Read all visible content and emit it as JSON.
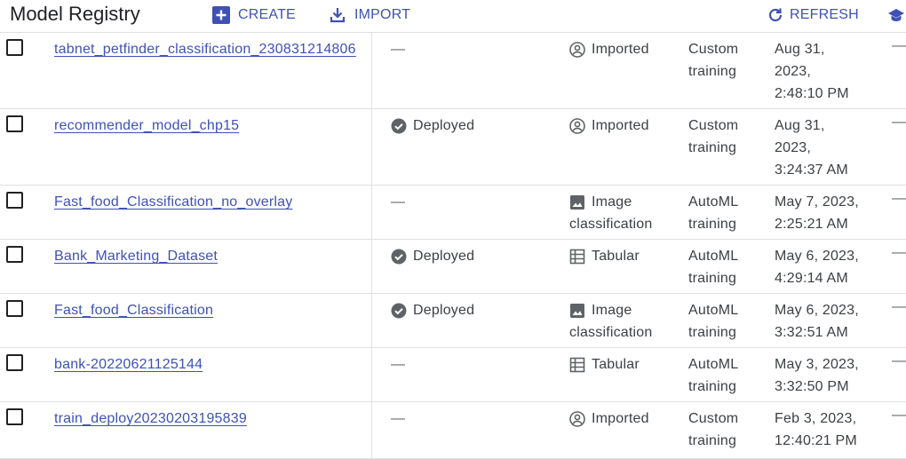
{
  "header": {
    "title": "Model Registry",
    "create_label": "CREATE",
    "import_label": "IMPORT",
    "refresh_label": "REFRESH"
  },
  "colors": {
    "accent": "#3f51b5",
    "text": "#3c4043",
    "divider": "#e0e0e0"
  },
  "rows": [
    {
      "name": "tabnet_petfinder_classification_230831214806",
      "status": "—",
      "status_icon": "",
      "source_icon": "account-circle-icon",
      "source_1": "Imported",
      "source_2": "",
      "type_1": "Custom",
      "type_2": "training",
      "updated_1": "Aug 31,",
      "updated_2": "2023,",
      "updated_3": "2:48:10 PM",
      "extra": "—"
    },
    {
      "name": "recommender_model_chp15",
      "status": "Deployed",
      "status_icon": "check-circle-icon",
      "source_icon": "account-circle-icon",
      "source_1": "Imported",
      "source_2": "",
      "type_1": "Custom",
      "type_2": "training",
      "updated_1": "Aug 31,",
      "updated_2": "2023,",
      "updated_3": "3:24:37 AM",
      "extra": "—"
    },
    {
      "name": "Fast_food_Classification_no_overlay",
      "status": "—",
      "status_icon": "",
      "source_icon": "image-icon",
      "source_1": "Image",
      "source_2": "classification",
      "type_1": "AutoML",
      "type_2": "training",
      "updated_1": "May 7, 2023,",
      "updated_2": "2:25:21 AM",
      "updated_3": "",
      "extra": "—"
    },
    {
      "name": "Bank_Marketing_Dataset",
      "status": "Deployed",
      "status_icon": "check-circle-icon",
      "source_icon": "table-icon",
      "source_1": "Tabular",
      "source_2": "",
      "type_1": "AutoML",
      "type_2": "training",
      "updated_1": "May 6, 2023,",
      "updated_2": "4:29:14 AM",
      "updated_3": "",
      "extra": "—"
    },
    {
      "name": "Fast_food_Classification",
      "status": "Deployed",
      "status_icon": "check-circle-icon",
      "source_icon": "image-icon",
      "source_1": "Image",
      "source_2": "classification",
      "type_1": "AutoML",
      "type_2": "training",
      "updated_1": "May 6, 2023,",
      "updated_2": "3:32:51 AM",
      "updated_3": "",
      "extra": "—"
    },
    {
      "name": "bank-20220621125144",
      "status": "—",
      "status_icon": "",
      "source_icon": "table-icon",
      "source_1": "Tabular",
      "source_2": "",
      "type_1": "AutoML",
      "type_2": "training",
      "updated_1": "May 3, 2023,",
      "updated_2": "3:32:50 PM",
      "updated_3": "",
      "extra": "—"
    },
    {
      "name": "train_deploy20230203195839",
      "status": "—",
      "status_icon": "",
      "source_icon": "account-circle-icon",
      "source_1": "Imported",
      "source_2": "",
      "type_1": "Custom",
      "type_2": "training",
      "updated_1": "Feb 3, 2023,",
      "updated_2": "12:40:21 PM",
      "updated_3": "",
      "extra": "—"
    }
  ]
}
